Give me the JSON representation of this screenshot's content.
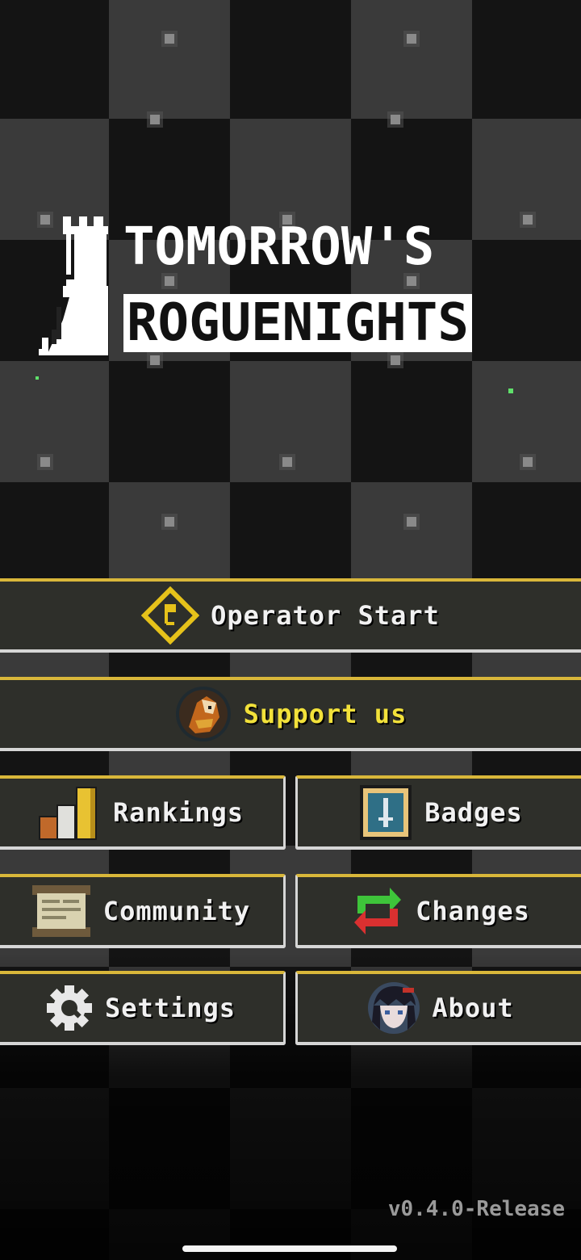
{
  "logo": {
    "line1": "TOMORROW'S",
    "line2": "ROGUENIGHTS"
  },
  "menu": {
    "operator_start": "Operator Start",
    "support_us": "Support us",
    "rankings": "Rankings",
    "badges": "Badges",
    "community": "Community",
    "changes": "Changes",
    "settings": "Settings",
    "about": "About"
  },
  "icons": {
    "operator_start": "diamond-flag-icon",
    "support_us": "supporter-portrait-icon",
    "rankings": "bar-chart-icon",
    "badges": "sword-badge-icon",
    "community": "scroll-icon",
    "changes": "swap-arrows-icon",
    "settings": "gear-icon",
    "about": "character-avatar-icon"
  },
  "colors": {
    "accent": "#d9b73a",
    "support_text": "#f2e13a",
    "button_bg": "#2e2f2a"
  },
  "version": "v0.4.0-Release"
}
